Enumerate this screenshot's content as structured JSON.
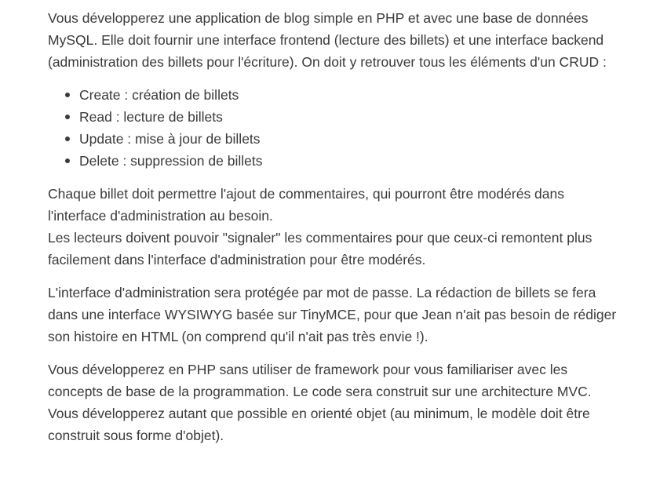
{
  "intro": "Vous développerez une application de blog simple en PHP et avec une base de données MySQL. Elle doit fournir une interface frontend (lecture des billets) et une interface backend (administration des billets pour l'écriture). On doit y retrouver tous les éléments d'un CRUD :",
  "crud_items": [
    "Create : création de billets",
    "Read : lecture de billets",
    "Update : mise à jour de billets",
    "Delete : suppression de billets"
  ],
  "comments_para": "Chaque billet doit permettre l'ajout de commentaires, qui pourront être modérés dans l'interface d'administration au besoin.",
  "report_para": "Les lecteurs doivent pouvoir \"signaler\" les commentaires pour que ceux-ci remontent plus facilement dans l'interface d'administration pour être modérés.",
  "admin_para": "L'interface d'administration sera protégée par mot de passe. La rédaction de billets se fera dans une interface WYSIWYG basée sur TinyMCE, pour que Jean n'ait pas besoin de rédiger son histoire en HTML (on comprend qu'il n'ait pas très envie !).",
  "php_para": "Vous développerez en PHP sans utiliser de framework pour vous familiariser avec les concepts de base de la programmation. Le code sera construit sur une architecture MVC. Vous développerez autant que possible en orienté objet (au minimum, le modèle doit être construit sous forme d'objet)."
}
